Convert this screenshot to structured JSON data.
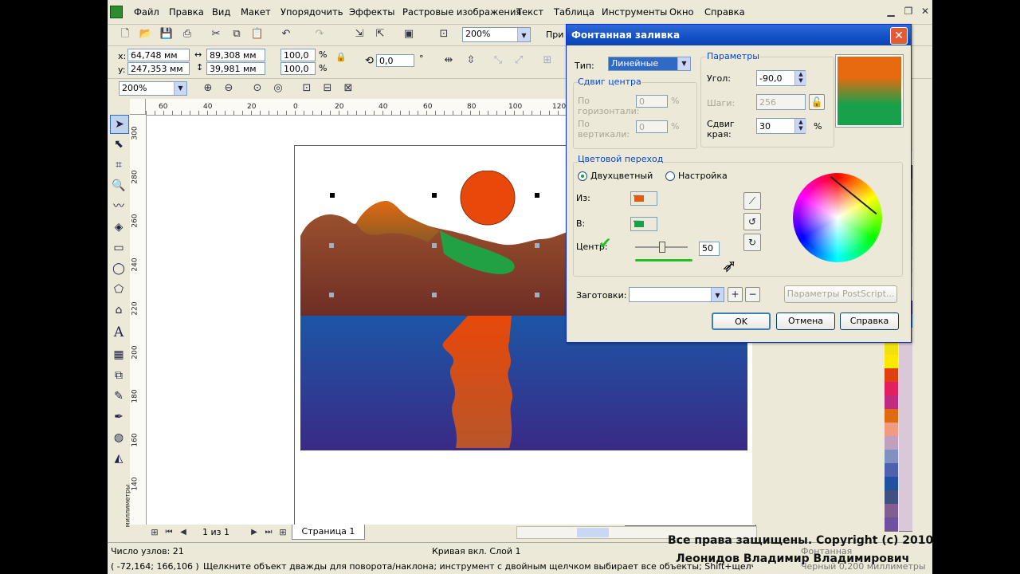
{
  "menu": [
    "Файл",
    "Правка",
    "Вид",
    "Макет",
    "Упорядочить",
    "Эффекты",
    "Растровые изображения",
    "Текст",
    "Таблица",
    "Инструменты",
    "Окно",
    "Справка"
  ],
  "toolbar": {
    "zoom_value": "200%",
    "zoom_value_2": "200%",
    "apply_label": "При"
  },
  "props": {
    "x": "64,748 мм",
    "y": "247,353 мм",
    "width": "89,308 мм",
    "height": "39,981 мм",
    "scale_w": "100,0",
    "scale_h": "100,0",
    "percent": "%",
    "rotation": "0,0",
    "degree": "°"
  },
  "rulers": {
    "h_ticks": [
      "60",
      "40",
      "20",
      "0",
      "20",
      "40",
      "60",
      "80",
      "100",
      "120"
    ],
    "v_ticks": [
      "300",
      "280",
      "260",
      "240",
      "220",
      "200",
      "180",
      "160",
      "140"
    ],
    "v_unit": "миллиметры"
  },
  "page_nav": {
    "page_count": "1 из 1",
    "page_tab": "Страница 1"
  },
  "status": {
    "nodes": "Число узлов: 21",
    "object": "Кривая вкл. Слой 1",
    "coords": "( -72,164; 166,106 )",
    "hint": "Щелкните объект дважды для поворота/наклона; инструмент с двойным щелчком выбирает все объекты; Shift+щелчок - выбор не...",
    "fill_name": "Фонтанная",
    "outline": "Черный  0,200 миллиметры"
  },
  "dialog": {
    "title": "Фонтанная заливка",
    "type_label": "Тип:",
    "type_value": "Линейные",
    "center_offset": {
      "title": "Сдвиг центра",
      "horizontal": "По горизонтали:",
      "vertical": "По вертикали:",
      "h_value": "0",
      "v_value": "0",
      "unit": "%"
    },
    "params": {
      "title": "Параметры",
      "angle_label": "Угол:",
      "angle_value": "-90,0",
      "steps_label": "Шаги:",
      "steps_value": "256",
      "edge_label": "Сдвиг края:",
      "edge_value": "30",
      "unit": "%"
    },
    "blend": {
      "title": "Цветовой переход",
      "two_color": "Двухцветный",
      "custom": "Настройка",
      "from": "Из:",
      "to": "В:",
      "center": "Центр:",
      "center_value": "50",
      "from_color": "#e05a10",
      "to_color": "#18a04a"
    },
    "presets_label": "Заготовки:",
    "postscript": "Параметры PostScript...",
    "ok": "OK",
    "cancel": "Отмена",
    "help": "Справка"
  },
  "watermark": {
    "line1": "Все права защищены. Copyright (c) 2010",
    "line2": "Леонидов Владимир Владимирович"
  },
  "colors": {
    "dialog_title": "#0d4fc2",
    "accent_green": "#21c021"
  }
}
